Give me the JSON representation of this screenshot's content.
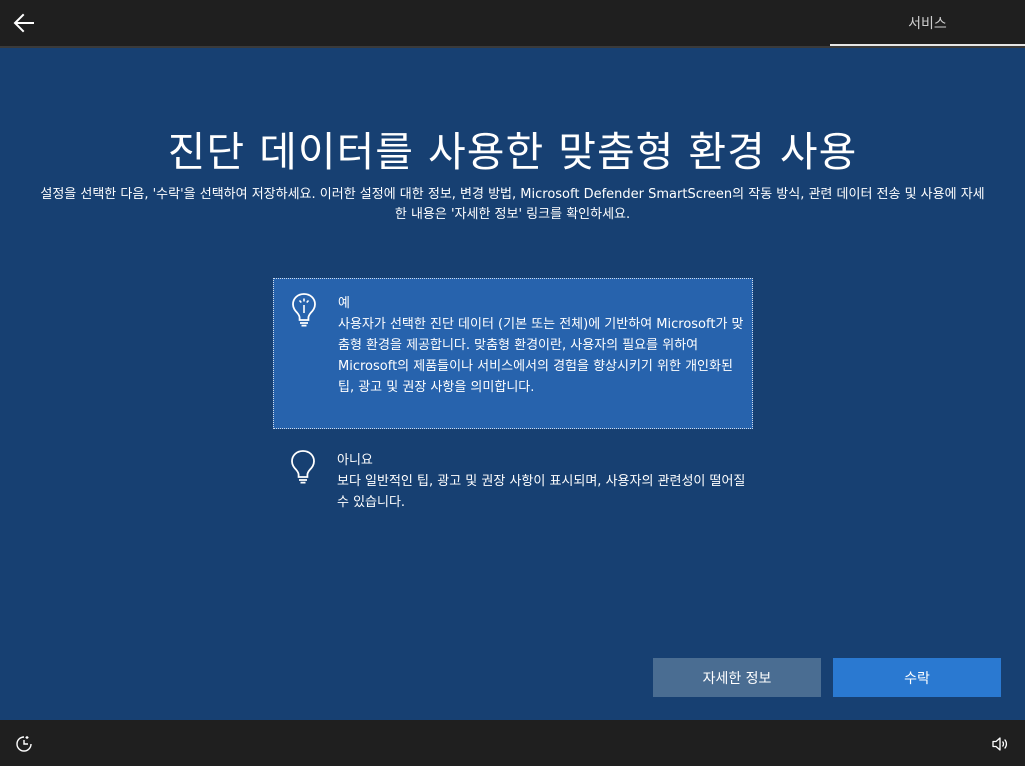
{
  "header": {
    "back_icon": "arrow-left-icon",
    "section_label": "서비스"
  },
  "main": {
    "title": "진단 데이터를 사용한 맞춤형 환경 사용",
    "description": "설정을 선택한 다음, '수락'을 선택하여 저장하세요. 이러한 설정에 대한 정보, 변경 방법, Microsoft Defender SmartScreen의 작동 방식, 관련 데이터 전송 및 사용에 자세한 내용은 '자세한 정보' 링크를 확인하세요.",
    "options": [
      {
        "icon": "lightbulb-on-icon",
        "title": "예",
        "body": "사용자가 선택한 진단 데이터 (기본 또는 전체)에 기반하여 Microsoft가 맞춤형 환경을 제공합니다. 맞춤형 환경이란, 사용자의 필요를 위하여 Microsoft의 제품들이나 서비스에서의 경험을 향상시키기 위한 개인화된 팁, 광고 및 권장 사항을 의미합니다.",
        "selected": true
      },
      {
        "icon": "lightbulb-off-icon",
        "title": "아니요",
        "body": "보다 일반적인 팁, 광고 및 권장 사항이 표시되며, 사용자의 관련성이 떨어질 수 있습니다.",
        "selected": false
      }
    ],
    "buttons": {
      "more_info": "자세한 정보",
      "accept": "수락"
    }
  },
  "footer": {
    "left_icon": "ease-of-access-icon",
    "right_icon": "volume-icon"
  },
  "colors": {
    "background": "#174072",
    "selected_option": "#2763ad",
    "accept_button": "#2a79d1",
    "secondary_button": "#4a6d92",
    "bar": "#1f1f1f"
  }
}
